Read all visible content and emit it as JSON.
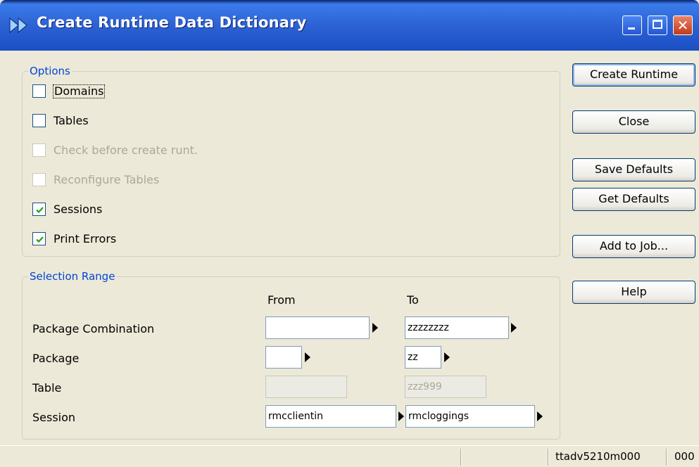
{
  "window": {
    "title": "Create Runtime Data Dictionary"
  },
  "options": {
    "legend": "Options",
    "items": [
      {
        "label": "Domains",
        "checked": false,
        "enabled": true
      },
      {
        "label": "Tables",
        "checked": false,
        "enabled": true
      },
      {
        "label": "Check before create runt.",
        "checked": false,
        "enabled": false
      },
      {
        "label": "Reconfigure Tables",
        "checked": false,
        "enabled": false
      },
      {
        "label": "Sessions",
        "checked": true,
        "enabled": true
      },
      {
        "label": "Print Errors",
        "checked": true,
        "enabled": true
      }
    ]
  },
  "selection": {
    "legend": "Selection Range",
    "from_header": "From",
    "to_header": "To",
    "rows": [
      {
        "label": "Package Combination",
        "from": "",
        "to": "zzzzzzzz"
      },
      {
        "label": "Package",
        "from": "",
        "to": "zz"
      },
      {
        "label": "Table",
        "from": "",
        "to": "zzz999"
      },
      {
        "label": "Session",
        "from": "rmcclientin",
        "to": "rmcloggings"
      }
    ]
  },
  "buttons": {
    "create_runtime": "Create Runtime",
    "close": "Close",
    "save_defaults": "Save Defaults",
    "get_defaults": "Get Defaults",
    "add_to_job": "Add to Job...",
    "help": "Help"
  },
  "status": {
    "session_code": "ttadv5210m000",
    "company": "000"
  },
  "colors": {
    "title_bar": "#2C62D4",
    "group_legend": "#0046D5",
    "window_bg": "#ECE9D8",
    "checkmark": "#21A121"
  },
  "icons": [
    "app-icon",
    "minimize-icon",
    "maximize-icon",
    "close-icon",
    "checkmark-icon",
    "zoom-arrow-icon"
  ]
}
